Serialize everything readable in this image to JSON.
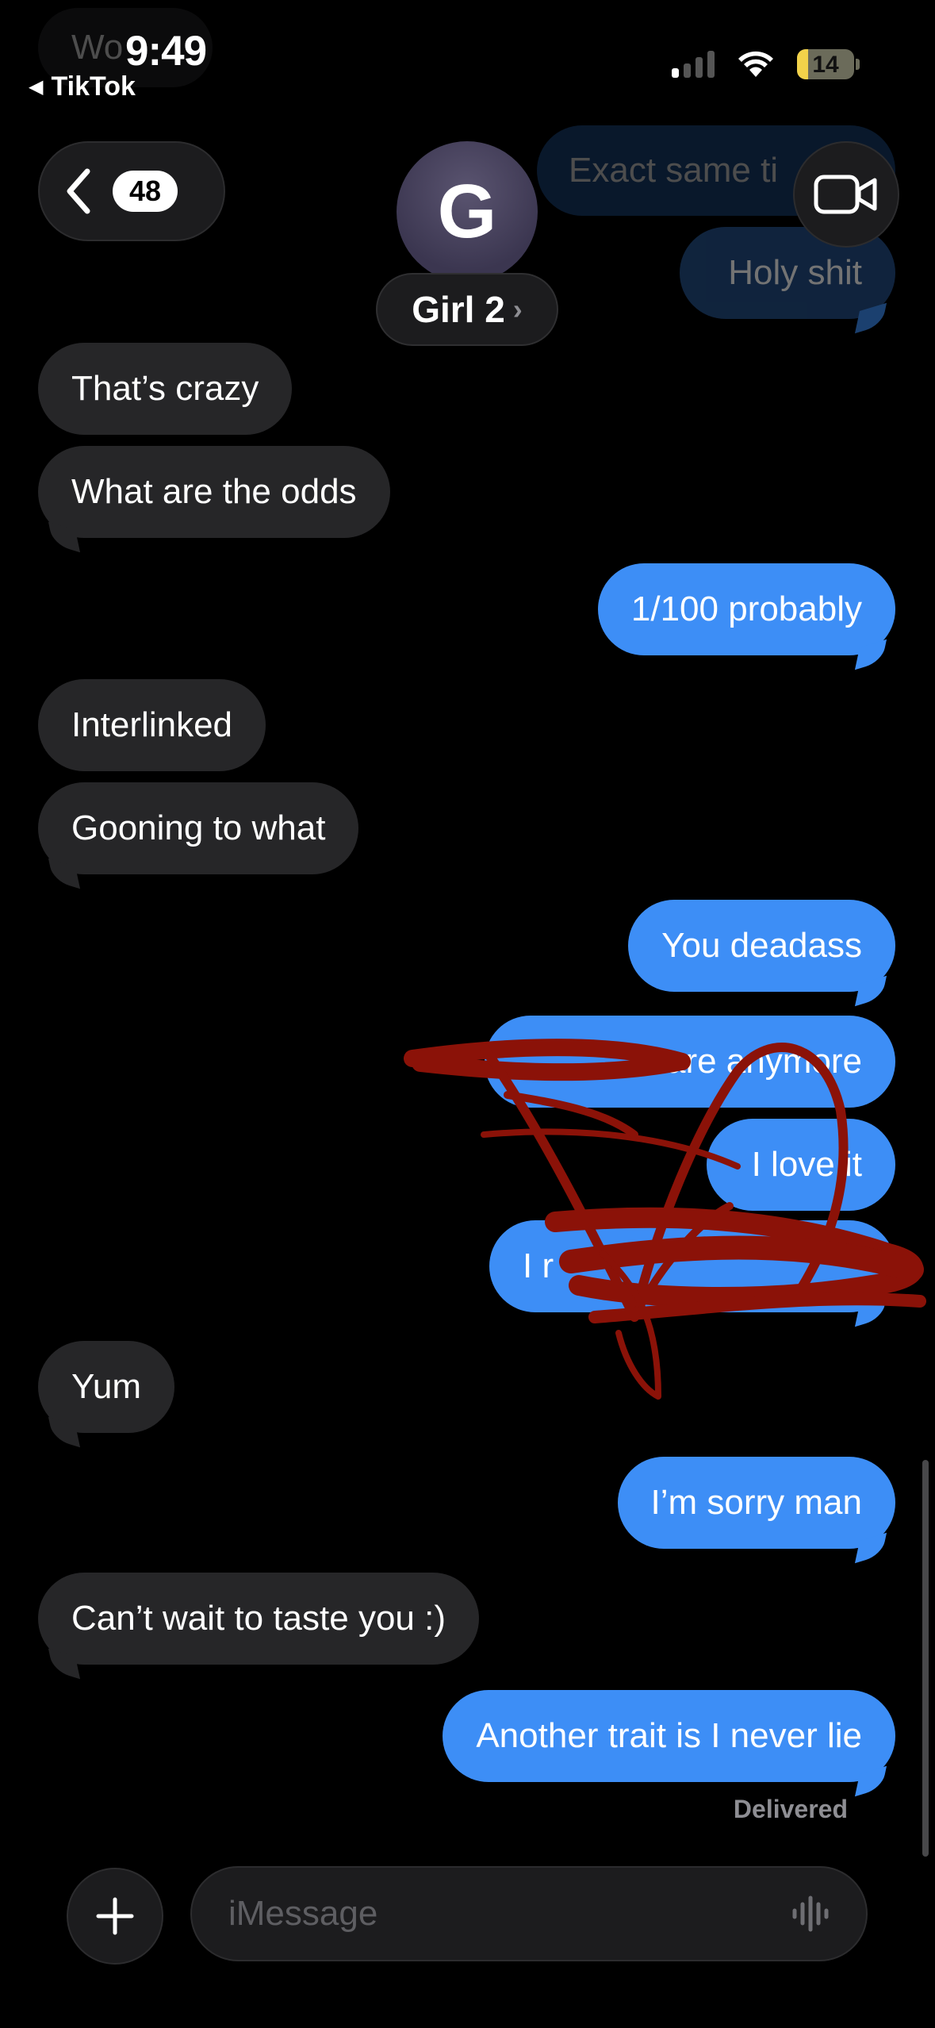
{
  "status_bar": {
    "time": "9:49",
    "back_app": "TikTok",
    "battery": "14"
  },
  "header": {
    "unread_count": "48",
    "contact_initial": "G",
    "contact_name": "Girl 2"
  },
  "messages": [
    {
      "side": "in",
      "text": "Wo",
      "faded": true
    },
    {
      "side": "out",
      "text": "Exact same ti",
      "faded": true
    },
    {
      "side": "out",
      "text": "Holy shit",
      "faded": true
    },
    {
      "side": "in",
      "text": "That’s crazy"
    },
    {
      "side": "in",
      "text": "What are the odds"
    },
    {
      "side": "out",
      "text": "1/100 probably"
    },
    {
      "side": "in",
      "text": "Interlinked"
    },
    {
      "side": "in",
      "text": "Gooning to what"
    },
    {
      "side": "out",
      "text": "You deadass"
    },
    {
      "side": "out",
      "text": "care anymore",
      "redacted": true
    },
    {
      "side": "out",
      "text": "I love it",
      "redacted": true
    },
    {
      "side": "out",
      "text": "I r",
      "redacted": true
    },
    {
      "side": "in",
      "text": "Yum"
    },
    {
      "side": "out",
      "text": "I’m sorry man"
    },
    {
      "side": "in",
      "text": "Can’t wait to taste you :)"
    },
    {
      "side": "out",
      "text": "Another trait is I never lie"
    }
  ],
  "delivered_label": "Delivered",
  "composer": {
    "placeholder": "iMessage"
  },
  "colors": {
    "outgoing_bubble": "#3d8ef6",
    "incoming_bubble": "#262628",
    "redaction_scribble": "#8b1208"
  }
}
